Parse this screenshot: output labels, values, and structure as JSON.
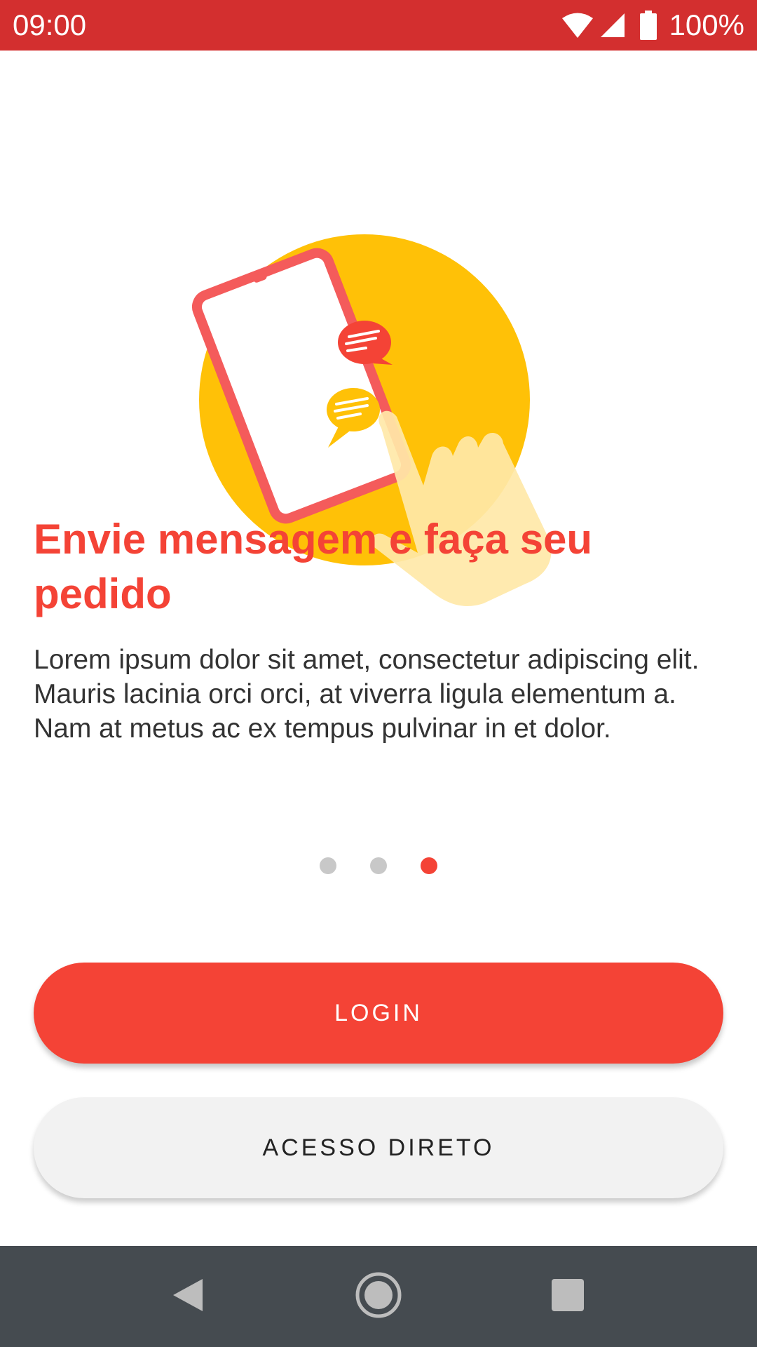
{
  "status_bar": {
    "time": "09:00",
    "battery": "100%",
    "icons": [
      "wifi-icon",
      "signal-icon",
      "battery-icon"
    ],
    "background_color": "#d32f2f"
  },
  "onboarding": {
    "illustration": "phone-chat-illustration",
    "title": "Envie mensagem e faça seu pedido",
    "description": "Lorem ipsum dolor sit amet, consectetur adipiscing elit. Mauris lacinia orci orci, at viverra ligula elementum a. Nam at metus ac ex tempus pulvinar in et dolor.",
    "title_color": "#f44336"
  },
  "pager": {
    "total_pages": 3,
    "active_page": 3,
    "active_color": "#f44336",
    "inactive_color": "#c8c8c8"
  },
  "actions": {
    "login_label": "LOGIN",
    "direct_access_label": "ACESSO DIRETO",
    "login_color": "#f44336"
  },
  "nav_bar": {
    "icons": [
      "back-icon",
      "home-icon",
      "recents-icon"
    ],
    "background_color": "#454b50"
  }
}
